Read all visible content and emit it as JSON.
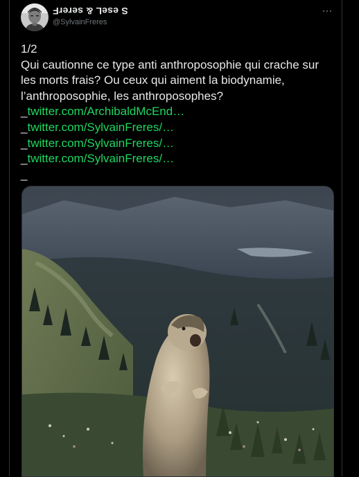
{
  "author": {
    "display_name": "S. Freres & Leser .S",
    "display_name_rendered": "S eseL & sererF",
    "handle": "@SylvainFreres"
  },
  "tweet": {
    "lines": [
      "1/2",
      "Qui cautionne ce type anti anthroposophie qui crache sur les morts frais? Ou ceux qui aiment la biodynamie, l’anthroposophie, les anthroposophes?"
    ],
    "links": [
      "twitter.com/ArchibaldMcEnd…",
      "twitter.com/SylvainFreres/…",
      "twitter.com/SylvainFreres/…",
      "twitter.com/SylvainFreres/…"
    ],
    "trailing": "_"
  },
  "media": {
    "type": "video-thumbnail",
    "subject": "marmot-standing"
  },
  "colors": {
    "background": "#000000",
    "text": "#e7e9ea",
    "link": "#1ed760",
    "secondary": "#71767b"
  }
}
